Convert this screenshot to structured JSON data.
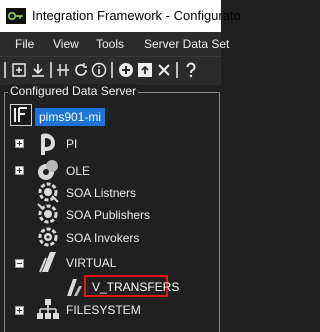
{
  "window": {
    "title": "Integration Framework - Configurato"
  },
  "menu": {
    "file": "File",
    "view": "View",
    "tools": "Tools",
    "server_data": "Server Data Set"
  },
  "toolbar": {
    "icons": [
      "import-icon",
      "download-icon",
      "fit-icon",
      "refresh-icon",
      "info-icon",
      "add-icon",
      "upload-icon",
      "delete-icon",
      "help-icon"
    ]
  },
  "panel": {
    "title": "Configured Data Server"
  },
  "tree": {
    "root": {
      "label": "pims901-mi",
      "icon": "if-logo-icon"
    },
    "pi": {
      "label": "PI"
    },
    "ole": {
      "label": "OLE"
    },
    "soa_listeners": {
      "label": "SOA Listners"
    },
    "soa_publishers": {
      "label": "SOA Publishers"
    },
    "soa_invokers": {
      "label": "SOA Invokers"
    },
    "virtual": {
      "label": "VIRTUAL"
    },
    "v_transfers": {
      "label": "V_TRANSFERS"
    },
    "filesystem": {
      "label": "FILESYSTEM"
    }
  },
  "colors": {
    "selection": "#1e74d6",
    "highlight_box": "#e0141e",
    "background": "#202020"
  }
}
